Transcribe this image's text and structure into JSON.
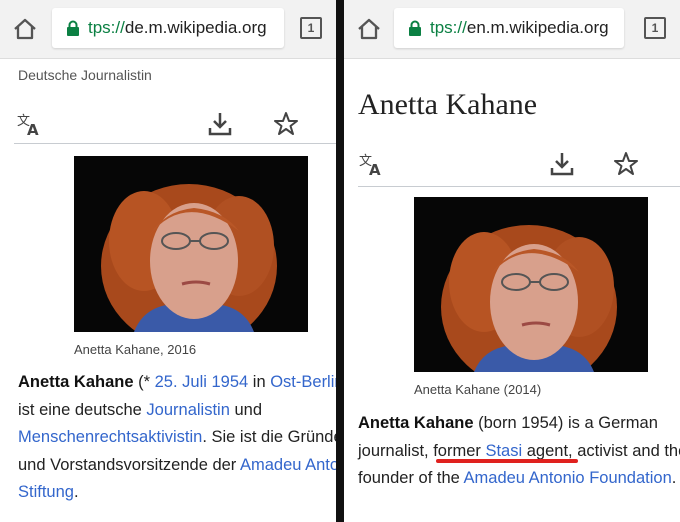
{
  "left": {
    "url": {
      "scheme": "tps://",
      "host": "de.m.wikipedia.org"
    },
    "tab_count": "1",
    "subtitle": "Deutsche Journalistin",
    "caption": "Anetta Kahane, 2016",
    "body": {
      "name": "Anetta Kahane",
      "t1": " (* ",
      "date_link": "25. Juli 1954",
      "t2": " in ",
      "place_link": "Ost-Berlin",
      "t3": " ist eine deutsche ",
      "link_journalist": "Journalistin",
      "t4": " und ",
      "link_activist": "Menschenrechtsaktivistin",
      "t5": ". Sie ist die Gründerin und Vorstandsvorsitzende der ",
      "link_foundation": "Amadeu Antonio Stiftung",
      "t6": "."
    }
  },
  "right": {
    "url": {
      "scheme": "tps://",
      "host": "en.m.wikipedia.org"
    },
    "tab_count": "1",
    "title": "Anetta Kahane",
    "caption": "Anetta Kahane (2014)",
    "body": {
      "name": "Anetta Kahane",
      "t1": " (born 1954) is a German journalist, former ",
      "link_stasi": "Stasi",
      "t2": " agent, activist and the founder of the ",
      "link_foundation": "Amadeu Antonio Foundation",
      "t3": "."
    }
  },
  "colors": {
    "link": "#3366cc",
    "secure": "#0b8043",
    "annotation": "#e0211e"
  }
}
